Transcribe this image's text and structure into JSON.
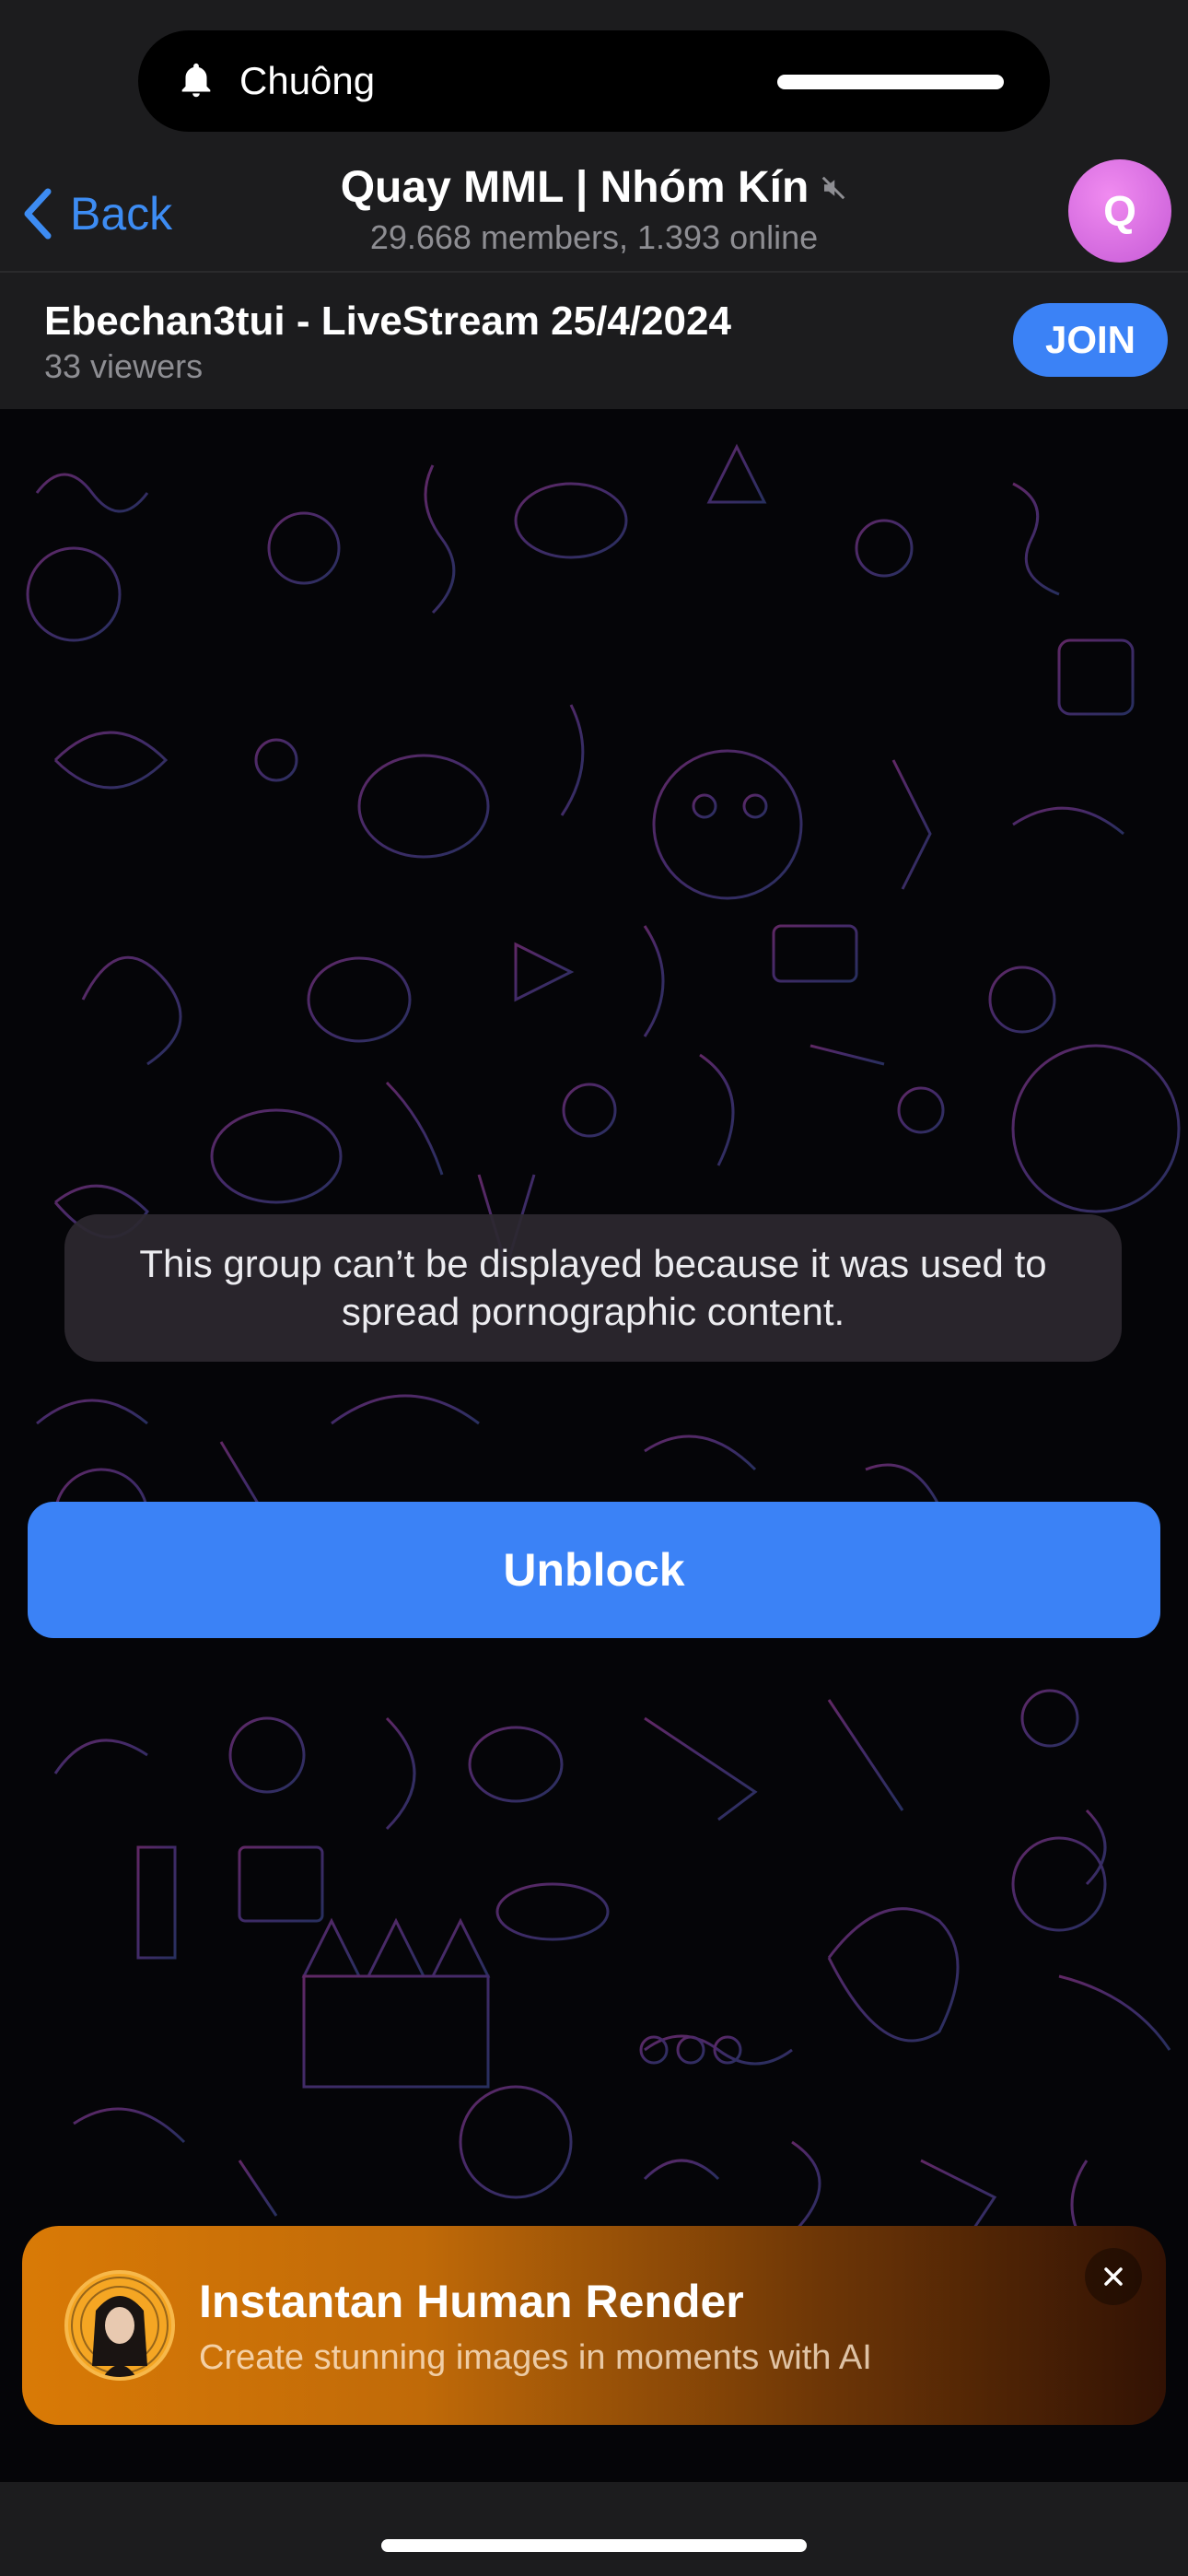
{
  "status_bar": {
    "notification_label": "Chuông"
  },
  "header": {
    "back_label": "Back",
    "title": "Quay MML | Nhóm Kín",
    "subtitle": "29.668 members, 1.393 online",
    "avatar_letter": "Q"
  },
  "live_stream": {
    "title": "Ebechan3tui - LiveStream 25/4/2024",
    "viewers": "33 viewers",
    "join_label": "JOIN"
  },
  "blocked": {
    "message": "This group can’t be displayed because it was used to spread pornographic content.",
    "unblock_label": "Unblock"
  },
  "ad": {
    "title": "Instantan Human Render",
    "subtitle": "Create stunning images in moments with AI"
  },
  "colors": {
    "accent": "#3b82f6",
    "header_bg": "#1c1c1e",
    "avatar": "#d96ee0",
    "ad_orange": "#d97a06"
  }
}
